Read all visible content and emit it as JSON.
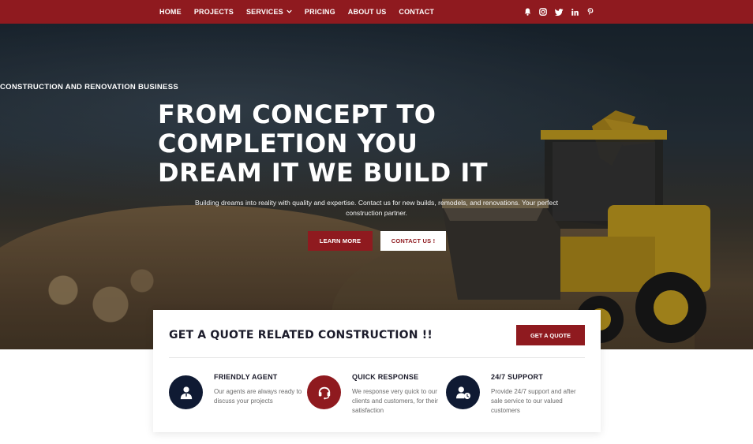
{
  "nav": {
    "items": [
      {
        "label": "HOME"
      },
      {
        "label": "PROJECTS"
      },
      {
        "label": "SERVICES"
      },
      {
        "label": "PRICING"
      },
      {
        "label": "ABOUT US"
      },
      {
        "label": "CONTACT"
      }
    ],
    "services_chevron": "⌄"
  },
  "social": [
    "bell-icon",
    "instagram-icon",
    "twitter-icon",
    "linkedin-icon",
    "pinterest-icon"
  ],
  "hero": {
    "kicker": "CONSTRUCTION AND RENOVATION BUSINESS",
    "headline_line1": "FROM CONCEPT TO",
    "headline_line2": "COMPLETION YOU",
    "headline_line3": "DREAM IT WE BUILD IT",
    "subtitle": "Building dreams into reality with quality and expertise. Contact us for new builds, remodels, and renovations. Your perfect construction partner.",
    "learn_more": "LEARN MORE",
    "contact_us": "CONTACT US !"
  },
  "quote": {
    "title": "GET A QUOTE RELATED CONSTRUCTION !!",
    "button": "GET A QUOTE",
    "features": [
      {
        "title": "FRIENDLY AGENT",
        "text": "Our agents are always ready to discuss your projects",
        "icon": "agent-icon",
        "color": "#0f1a33"
      },
      {
        "title": "QUICK RESPONSE",
        "text": "We response very quick to our clients and customers, for their satisfaction",
        "icon": "headset-icon",
        "color": "#8f1a1f"
      },
      {
        "title": "24/7 SUPPORT",
        "text": "Provide 24/7 support and after sale service to our valued customers",
        "icon": "support-clock-icon",
        "color": "#0f1a33"
      }
    ]
  },
  "colors": {
    "brand": "#8f1a1f",
    "navy": "#0f1a33"
  }
}
